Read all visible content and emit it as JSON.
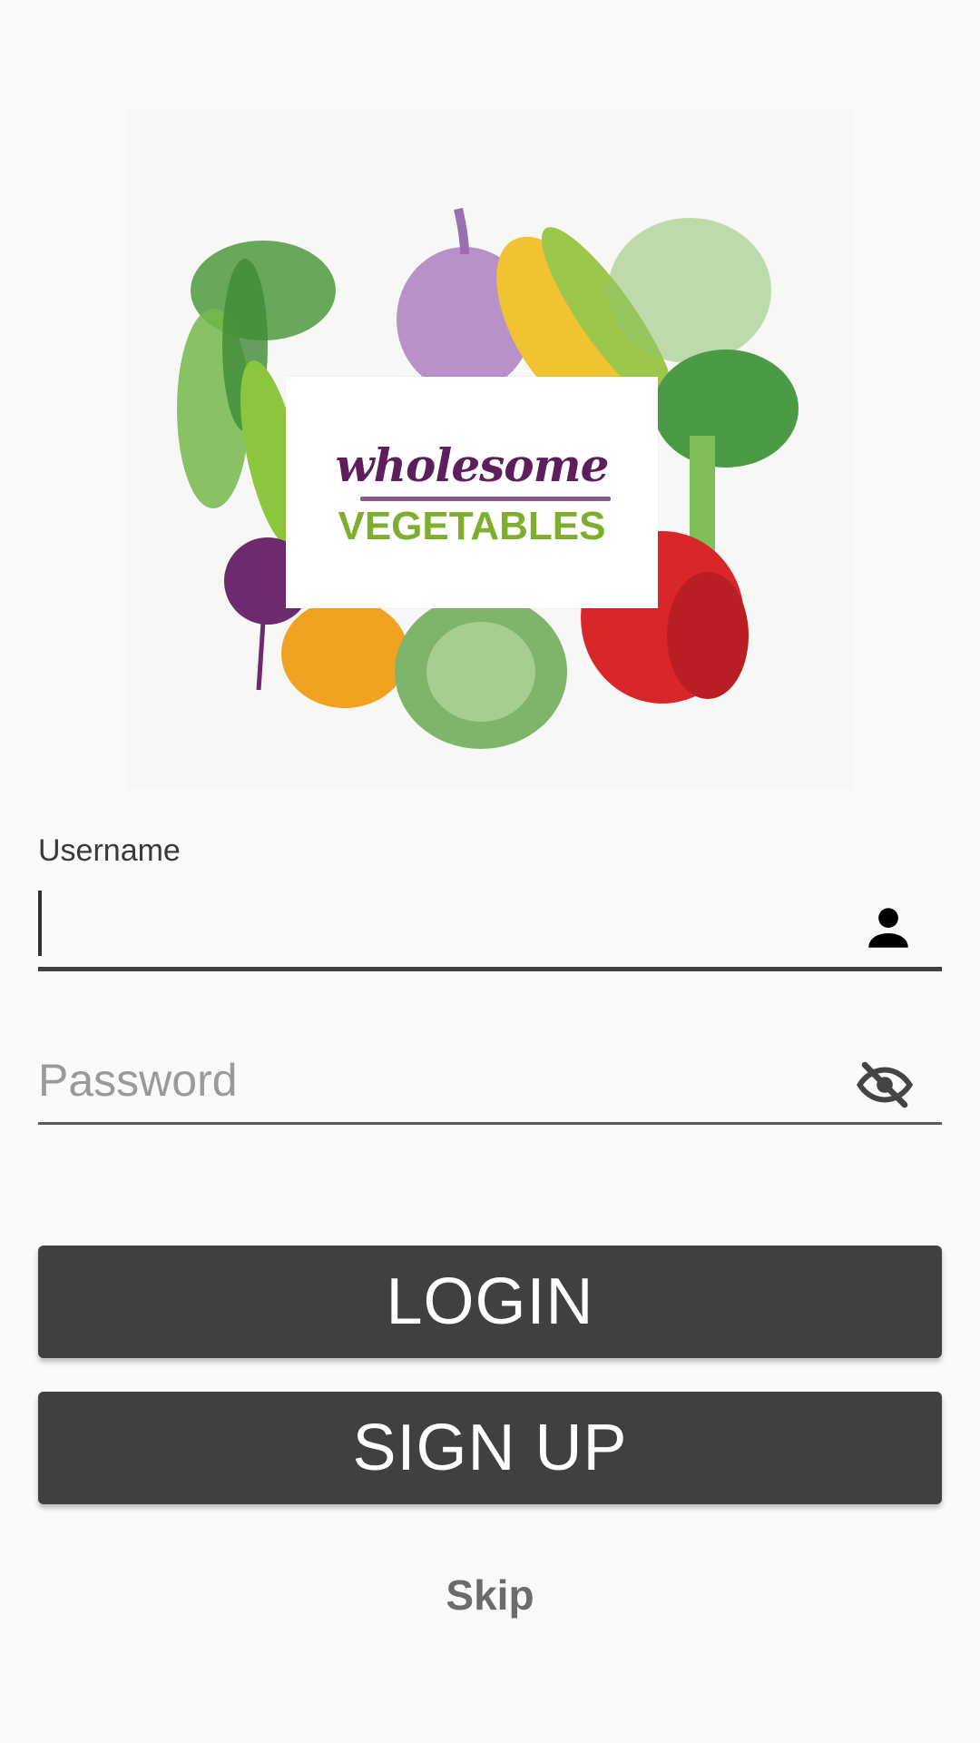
{
  "logo": {
    "line1": "wholesome",
    "line2": "VEGETABLES"
  },
  "form": {
    "username_label": "Username",
    "username_value": "",
    "username_icon": "person-icon",
    "password_placeholder": "Password",
    "password_icon": "visibility-off-icon"
  },
  "buttons": {
    "login": "LOGIN",
    "signup": "SIGN UP",
    "skip": "Skip"
  },
  "colors": {
    "button_bg": "#404040",
    "button_text": "#ffffff",
    "logo_purple": "#5e1e5e",
    "logo_green": "#7fae2e",
    "skip_text": "#6b6b6b"
  }
}
